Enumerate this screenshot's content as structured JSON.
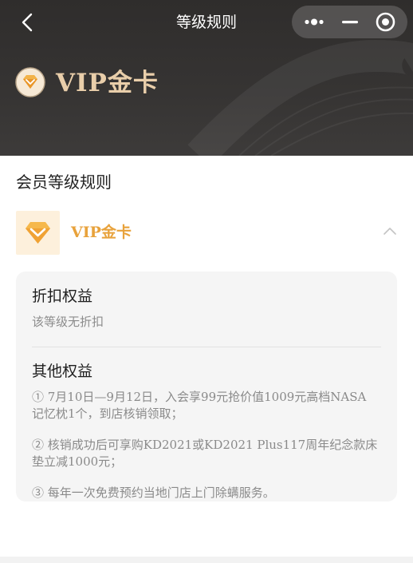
{
  "nav": {
    "title": "等级规则",
    "back_icon": "chevron-left-icon",
    "capsule_icons": [
      "more-dots-icon",
      "minimize-icon",
      "close-circle-icon"
    ]
  },
  "hero": {
    "badge_icon": "diamond-badge-icon",
    "title": "VIP金卡",
    "colors": {
      "background": "#333130",
      "title": "#e9ceaa"
    }
  },
  "main": {
    "section_title": "会员等级规则",
    "level": {
      "icon": "diamond-badge-icon",
      "name": "VIP金卡",
      "expanded_icon": "chevron-up-icon",
      "colors": {
        "name": "#e8a23b",
        "icon_bg": "#fdf0dc"
      }
    },
    "card": {
      "discount_title": "折扣权益",
      "discount_text": "该等级无折扣",
      "other_title": "其他权益",
      "benefits": [
        {
          "line1": "① 7月10日—9月12日，入会享99元抢价值1009元高档NASA",
          "line2": "记忆枕1个，到店核销领取；"
        },
        {
          "line1": "② 核销成功后可享购KD2021或KD2021 Plus117周年纪念款床",
          "line2": "垫立减1000元；"
        },
        {
          "line1": "③ 每年一次免费预约当地门店上门除螨服务。",
          "line2": ""
        }
      ]
    }
  }
}
